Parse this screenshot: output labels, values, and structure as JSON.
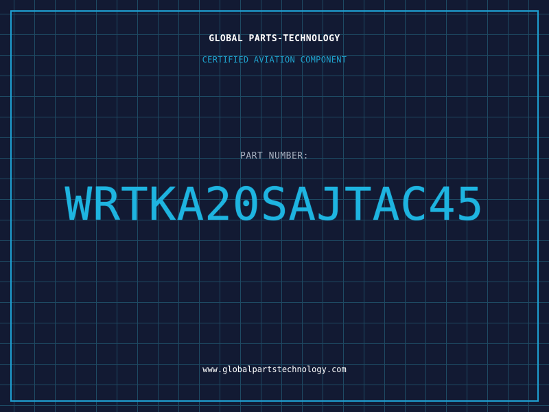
{
  "header": {
    "company": "GLOBAL PARTS-TECHNOLOGY",
    "subtitle": "CERTIFIED AVIATION COMPONENT"
  },
  "part": {
    "label": "PART NUMBER:",
    "number": "WRTKA20SAJTAC45"
  },
  "footer": {
    "website": "www.globalpartstechnology.com"
  },
  "colors": {
    "background": "#121a33",
    "grid": "#1e4a63",
    "accent": "#1eb4e0",
    "frame": "#1e9fd1"
  }
}
